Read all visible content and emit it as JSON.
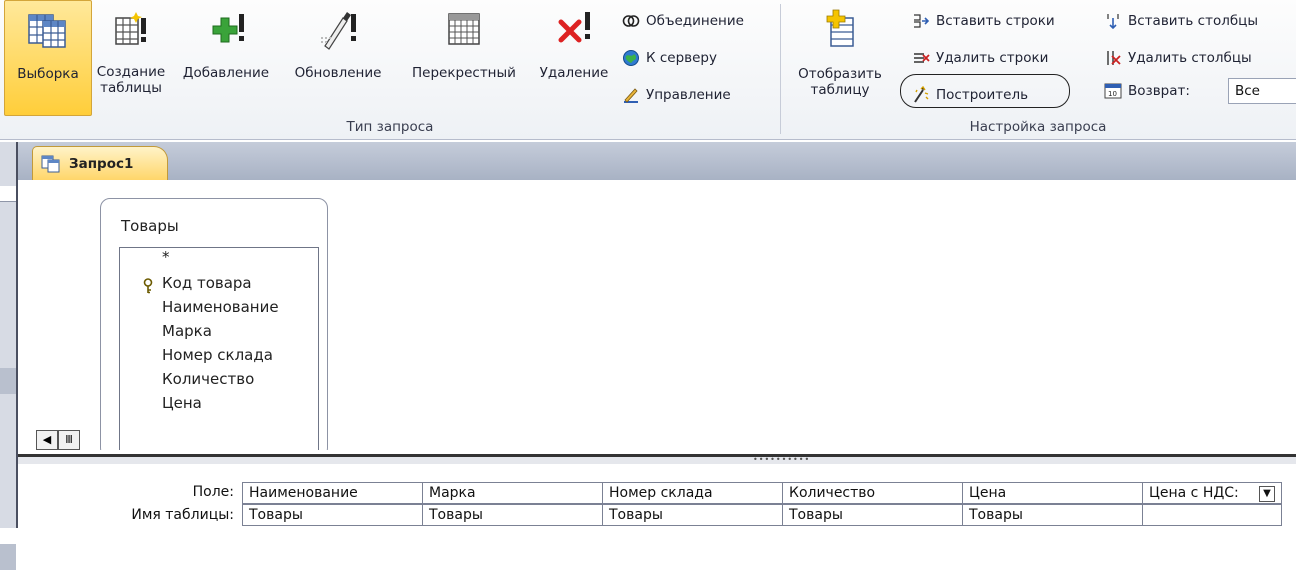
{
  "ribbon": {
    "query_type_buttons": [
      {
        "label": "Выборка",
        "icon": "select-query-icon",
        "selected": true
      },
      {
        "label": "Создание\nтаблицы",
        "icon": "make-table-icon"
      },
      {
        "label": "Добавление",
        "icon": "append-query-icon"
      },
      {
        "label": "Обновление",
        "icon": "update-query-icon"
      },
      {
        "label": "Перекрестный",
        "icon": "crosstab-query-icon"
      },
      {
        "label": "Удаление",
        "icon": "delete-query-icon"
      }
    ],
    "sql_specific": [
      {
        "label": "Объединение",
        "icon": "union-icon"
      },
      {
        "label": "К серверу",
        "icon": "pass-through-icon"
      },
      {
        "label": "Управление",
        "icon": "data-definition-icon"
      }
    ],
    "group_query_type_label": "Тип запроса",
    "show_table_label": "Отобразить\nтаблицу",
    "rows_commands": [
      {
        "label": "Вставить строки",
        "icon": "insert-rows-icon"
      },
      {
        "label": "Удалить строки",
        "icon": "delete-rows-icon"
      },
      {
        "label": "Построитель",
        "icon": "builder-icon"
      }
    ],
    "column_commands": [
      {
        "label": "Вставить столбцы",
        "icon": "insert-columns-icon"
      },
      {
        "label": "Удалить столбцы",
        "icon": "delete-columns-icon"
      }
    ],
    "return_label": "Возврат:",
    "return_value": "Все",
    "group_query_setup_label": "Настройка запроса"
  },
  "document_tab": {
    "title": "Запрос1"
  },
  "table": {
    "title": "Товары",
    "fields": [
      "*",
      "Код товара",
      "Наименование",
      "Марка",
      "Номер склада",
      "Количество",
      "Цена"
    ],
    "primary_key": "Код товара"
  },
  "grid": {
    "row_labels": [
      "Поле:",
      "Имя таблицы:"
    ],
    "columns": [
      {
        "field": "Наименование",
        "table": "Товары"
      },
      {
        "field": "Марка",
        "table": "Товары"
      },
      {
        "field": "Номер склада",
        "table": "Товары"
      },
      {
        "field": "Количество",
        "table": "Товары"
      },
      {
        "field": "Цена",
        "table": "Товары"
      },
      {
        "field": "Цена с НДС:",
        "table": ""
      }
    ]
  },
  "colors": {
    "selected_button": "#ffce3a",
    "tab": "#ffd66a",
    "ribbon_bg": "#eef1f5"
  }
}
